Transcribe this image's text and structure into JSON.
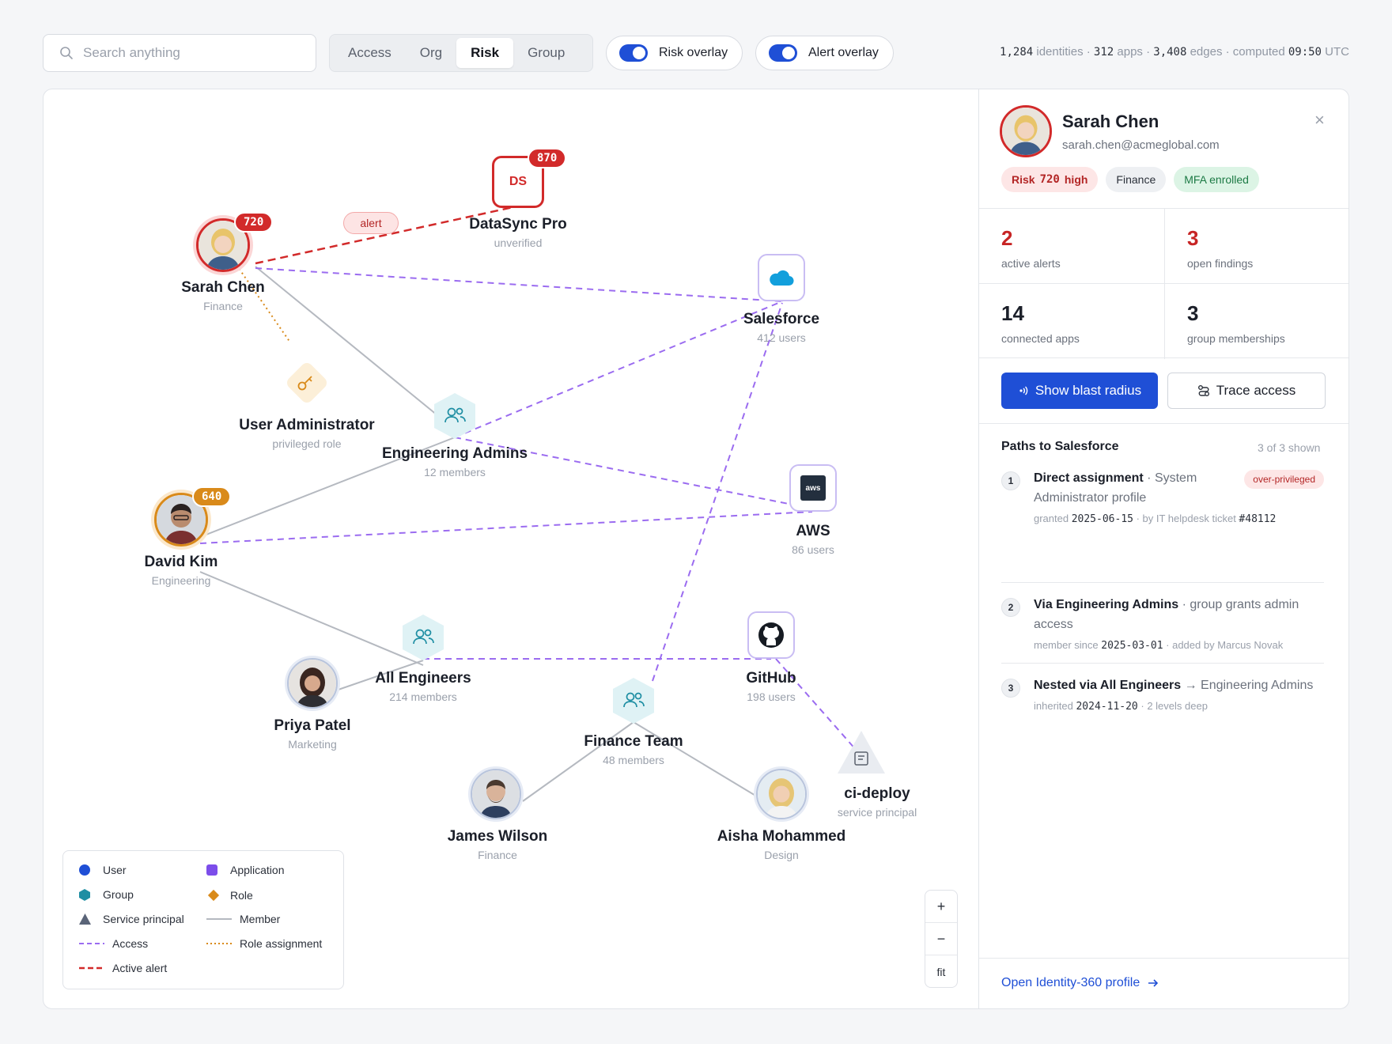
{
  "search": {
    "placeholder": "Search anything"
  },
  "views": [
    "Access",
    "Org",
    "Risk",
    "Group"
  ],
  "active_view": "Risk",
  "toggles": {
    "risk_overlay": "Risk overlay",
    "alert_overlay": "Alert overlay"
  },
  "stats": {
    "identities": "1,284",
    "identities_label": "identities ·",
    "apps": "312",
    "apps_label": "apps ·",
    "edges": "3,408",
    "edges_label": "edges · computed",
    "time": "09:50",
    "tz": "UTC"
  },
  "graph": {
    "alert_label": "alert",
    "nodes": {
      "sarah": {
        "name": "Sarah Chen",
        "sub": "Finance",
        "risk": "720"
      },
      "datasync": {
        "name": "DataSync Pro",
        "sub": "unverified",
        "risk": "870",
        "initials": "DS"
      },
      "salesforce": {
        "name": "Salesforce",
        "sub": "412 users"
      },
      "user_admin": {
        "name": "User Administrator",
        "sub": "privileged role"
      },
      "eng_admins": {
        "name": "Engineering Admins",
        "sub": "12 members"
      },
      "aws": {
        "name": "AWS",
        "sub": "86 users",
        "logo": "aws"
      },
      "david": {
        "name": "David Kim",
        "sub": "Engineering",
        "risk": "640"
      },
      "all_eng": {
        "name": "All Engineers",
        "sub": "214 members"
      },
      "github": {
        "name": "GitHub",
        "sub": "198 users"
      },
      "priya": {
        "name": "Priya Patel",
        "sub": "Marketing"
      },
      "finance_team": {
        "name": "Finance Team",
        "sub": "48 members"
      },
      "ci_deploy": {
        "name": "ci-deploy",
        "sub": "service principal"
      },
      "james": {
        "name": "James Wilson",
        "sub": "Finance"
      },
      "aisha": {
        "name": "Aisha Mohammed",
        "sub": "Design"
      }
    }
  },
  "legend": {
    "user": "User",
    "application": "Application",
    "group": "Group",
    "role": "Role",
    "service_principal": "Service principal",
    "member": "Member",
    "access": "Access",
    "role_assignment": "Role assignment",
    "active_alert": "Active alert"
  },
  "zoom": {
    "in": "+",
    "out": "−",
    "fit": "fit"
  },
  "panel": {
    "name": "Sarah Chen",
    "email": "sarah.chen@acmeglobal.com",
    "close": "×",
    "chips": {
      "risk_prefix": "Risk",
      "risk_value": "720",
      "risk_level": "high",
      "dept": "Finance",
      "mfa": "MFA enrolled"
    },
    "metrics": [
      {
        "value": "2",
        "label": "active alerts"
      },
      {
        "value": "3",
        "label": "open findings"
      },
      {
        "value": "14",
        "label": "connected apps"
      },
      {
        "value": "3",
        "label": "group memberships"
      }
    ],
    "buttons": {
      "blast": "Show blast radius",
      "trace": "Trace access"
    },
    "paths_title": "Paths to Salesforce",
    "paths_count": "3 of 3 shown",
    "paths": [
      {
        "num": "1",
        "title_bold": "Direct assignment",
        "title_rest": " · System Administrator profile",
        "tag": "over-privileged",
        "meta_a": "granted ",
        "meta_date": "2025-06-15",
        "meta_b": " · by IT helpdesk ticket ",
        "meta_ticket": "#48112"
      },
      {
        "num": "2",
        "title_bold": "Via Engineering Admins",
        "title_rest": " · group grants admin access",
        "meta_a": "member since ",
        "meta_date": "2025-03-01",
        "meta_b": " · added by Marcus Novak"
      },
      {
        "num": "3",
        "title_bold": "Nested via All Engineers",
        "title_rest": " → Engineering Admins",
        "meta_a": "inherited ",
        "meta_date": "2024-11-20",
        "meta_b": " · 2 levels deep"
      }
    ],
    "footer_link": "Open Identity-360 profile"
  },
  "colors": {
    "accent": "#1f4fd6",
    "alert": "#d22a2a",
    "access": "#9b6cf0",
    "role": "#d98a1a",
    "group": "#1e8ea3",
    "member": "#b5b9c0"
  }
}
